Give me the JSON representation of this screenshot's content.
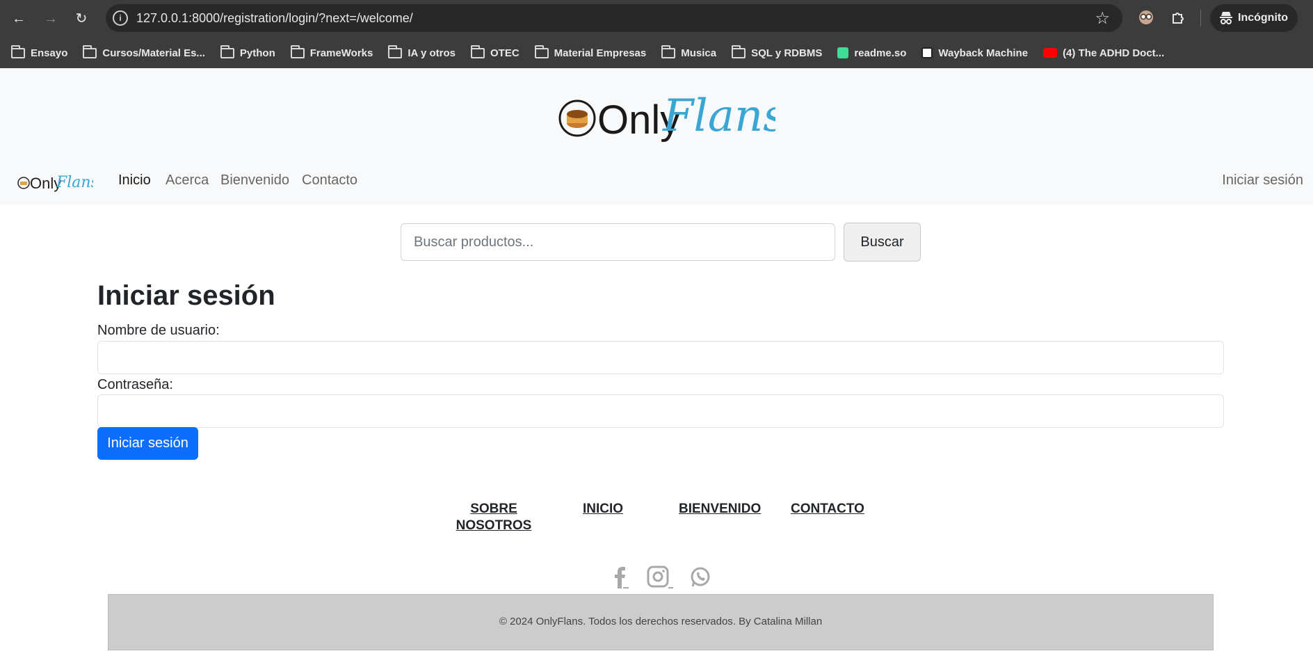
{
  "browser": {
    "url": "127.0.0.1:8000/registration/login/?next=/welcome/",
    "incognito_label": "Incógnito",
    "bookmarks": [
      {
        "label": "Ensayo",
        "icon": "folder-icon"
      },
      {
        "label": "Cursos/Material Es...",
        "icon": "folder-icon"
      },
      {
        "label": "Python",
        "icon": "folder-icon"
      },
      {
        "label": "FrameWorks",
        "icon": "folder-icon"
      },
      {
        "label": "IA y otros",
        "icon": "folder-icon"
      },
      {
        "label": "OTEC",
        "icon": "folder-icon"
      },
      {
        "label": "Material Empresas",
        "icon": "folder-icon"
      },
      {
        "label": "Musica",
        "icon": "folder-icon"
      },
      {
        "label": "SQL y RDBMS",
        "icon": "folder-icon"
      },
      {
        "label": "readme.so",
        "icon": "readme-icon"
      },
      {
        "label": "Wayback Machine",
        "icon": "wayback-icon"
      },
      {
        "label": "(4) The ADHD Doct...",
        "icon": "youtube-icon"
      }
    ]
  },
  "brand": {
    "logo_text_dark": "Only",
    "logo_text_script": "Flans",
    "accent_color": "#3aa6d3"
  },
  "navbar": {
    "links": [
      "Inicio",
      "Acerca",
      "Bienvenido",
      "Contacto"
    ],
    "login": "Iniciar sesión"
  },
  "search": {
    "placeholder": "Buscar productos...",
    "button": "Buscar"
  },
  "login": {
    "title": "Iniciar sesión",
    "username_label": "Nombre de usuario:",
    "password_label": "Contraseña:",
    "submit": "Iniciar sesión",
    "button_color": "#0d6efd"
  },
  "footer": {
    "links": {
      "about_line1": "SOBRE",
      "about_line2": "NOSOTROS",
      "home": "INICIO",
      "welcome": "BIENVENIDO",
      "contact": "CONTACTO"
    },
    "social_icons": [
      "facebook-icon",
      "instagram-icon",
      "whatsapp-icon"
    ],
    "copyright": "© 2024 OnlyFlans. Todos los derechos reservados. By Catalina Millan"
  }
}
